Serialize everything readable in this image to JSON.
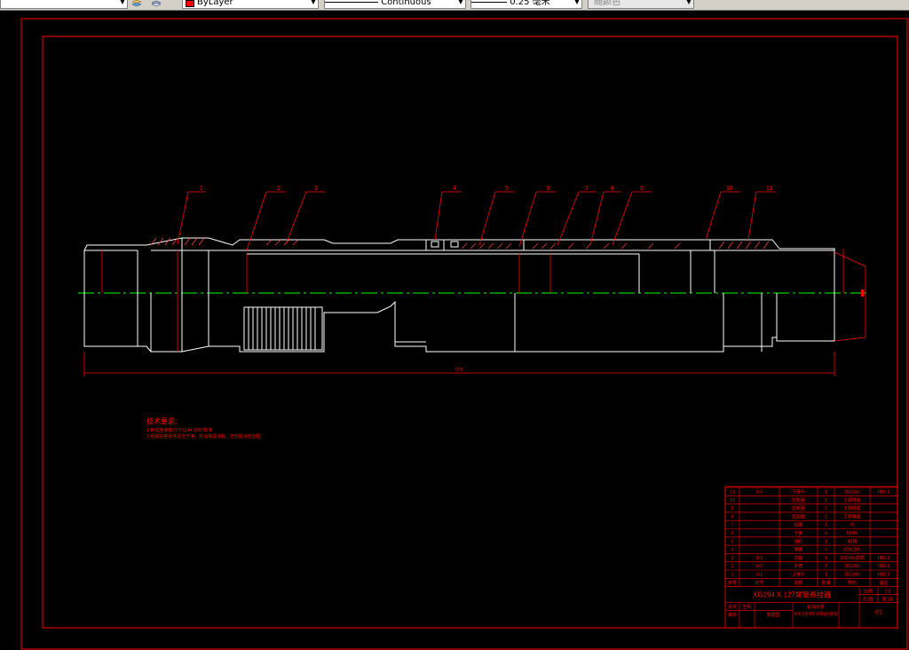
{
  "toolbar": {
    "layer_value": "ByLayer",
    "linetype_value": "Continuous",
    "lineweight_value": "0.25 毫米",
    "plotstyle_value": "随颜色"
  },
  "colors": {
    "border": "#ff0000",
    "lines": "#ffffff",
    "centerline": "#00ff00",
    "background": "#000000"
  },
  "drawing": {
    "balloons": [
      "1",
      "2",
      "3",
      "4",
      "5",
      "6",
      "7",
      "8",
      "9",
      "10",
      "11"
    ],
    "overall_dim": "978",
    "tech_title": "技术要求:",
    "tech_line1": "1.螺纹连接按SY/T5144-2007标准",
    "tech_line2": "2.组装前各零件清洗干净，并涂抹润滑脂，密封处涂密封胶"
  },
  "bom": {
    "rows": [
      {
        "no": "11",
        "code": "0-5",
        "name": "下接头",
        "qty": "1",
        "material": "35CrMo",
        "note": "HB1.5"
      },
      {
        "no": "10",
        "code": "",
        "name": "密封圈",
        "qty": "2",
        "material": "丁腈橡胶",
        "note": ""
      },
      {
        "no": "9",
        "code": "",
        "name": "密封圈",
        "qty": "2",
        "material": "丁腈橡胶",
        "note": ""
      },
      {
        "no": "8",
        "code": "",
        "name": "密封圈",
        "qty": "2",
        "material": "丁腈橡胶",
        "note": ""
      },
      {
        "no": "7",
        "code": "",
        "name": "挡圈",
        "qty": "1",
        "material": "45",
        "note": ""
      },
      {
        "no": "6",
        "code": "",
        "name": "卡簧",
        "qty": "4",
        "material": "65Mn",
        "note": ""
      },
      {
        "no": "5",
        "code": "",
        "name": "销钉",
        "qty": "1",
        "material": "45钢",
        "note": ""
      },
      {
        "no": "4",
        "code": "",
        "name": "弹簧",
        "qty": "4",
        "material": "60Si2Mn",
        "note": ""
      },
      {
        "no": "3",
        "code": "0-3",
        "name": "芯轴",
        "qty": "1",
        "material": "35CrMo调质",
        "note": "HB1.5"
      },
      {
        "no": "2",
        "code": "0-2",
        "name": "外筒",
        "qty": "1",
        "material": "35CrMo",
        "note": "HB1.5"
      },
      {
        "no": "1",
        "code": "0-1",
        "name": "上接头",
        "qty": "1",
        "material": "35CrMo",
        "note": "HB1.5"
      }
    ],
    "header": {
      "no": "序号",
      "code": "代号",
      "name": "名称",
      "qty": "数量",
      "material": "材料",
      "note": "备注"
    },
    "title": "XG194 X 127尾管悬挂器",
    "scale_label": "比例",
    "scale_value": "1:5",
    "sheet_label": "共1张",
    "sheet_no": "第1张",
    "drawn_label": "设计",
    "checked_label": "审核",
    "drawn_by": "王明",
    "checked_by": "李建国",
    "school": "石油大学",
    "dept": "机电工程学院 机械设计制造",
    "drawing_no": "01"
  }
}
